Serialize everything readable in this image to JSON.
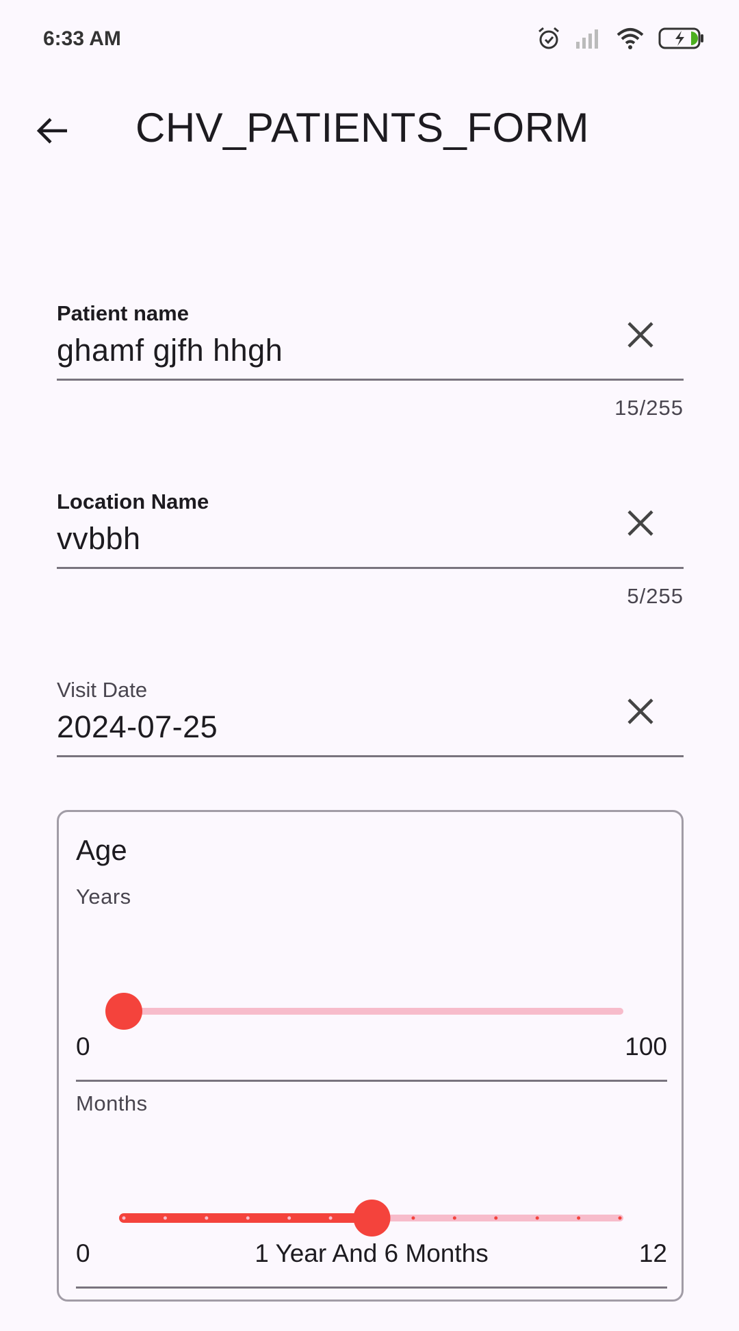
{
  "status_bar": {
    "time": "6:33 AM",
    "icons": [
      "alarm-icon",
      "signal-icon",
      "wifi-icon",
      "battery-charging-icon"
    ]
  },
  "app_bar": {
    "title": "CHV_PATIENTS_FORM",
    "back_icon": "arrow-back-icon"
  },
  "form": {
    "patient_name": {
      "label": "Patient name",
      "value": "ghamf gjfh hhgh",
      "counter": "15/255"
    },
    "location_name": {
      "label": "Location Name",
      "value": "vvbbh",
      "counter": "5/255"
    },
    "visit_date": {
      "label": "Visit Date",
      "value": "2024-07-25"
    }
  },
  "age": {
    "title": "Age",
    "years": {
      "label": "Years",
      "min": "0",
      "max": "100",
      "value": 0
    },
    "months": {
      "label": "Months",
      "min": "0",
      "max": "12",
      "value": 6,
      "summary": "1 Year And 6 Months"
    }
  },
  "colors": {
    "accent": "#f4433c",
    "track_inactive": "#f7bccb",
    "background": "#fcf8fe"
  }
}
